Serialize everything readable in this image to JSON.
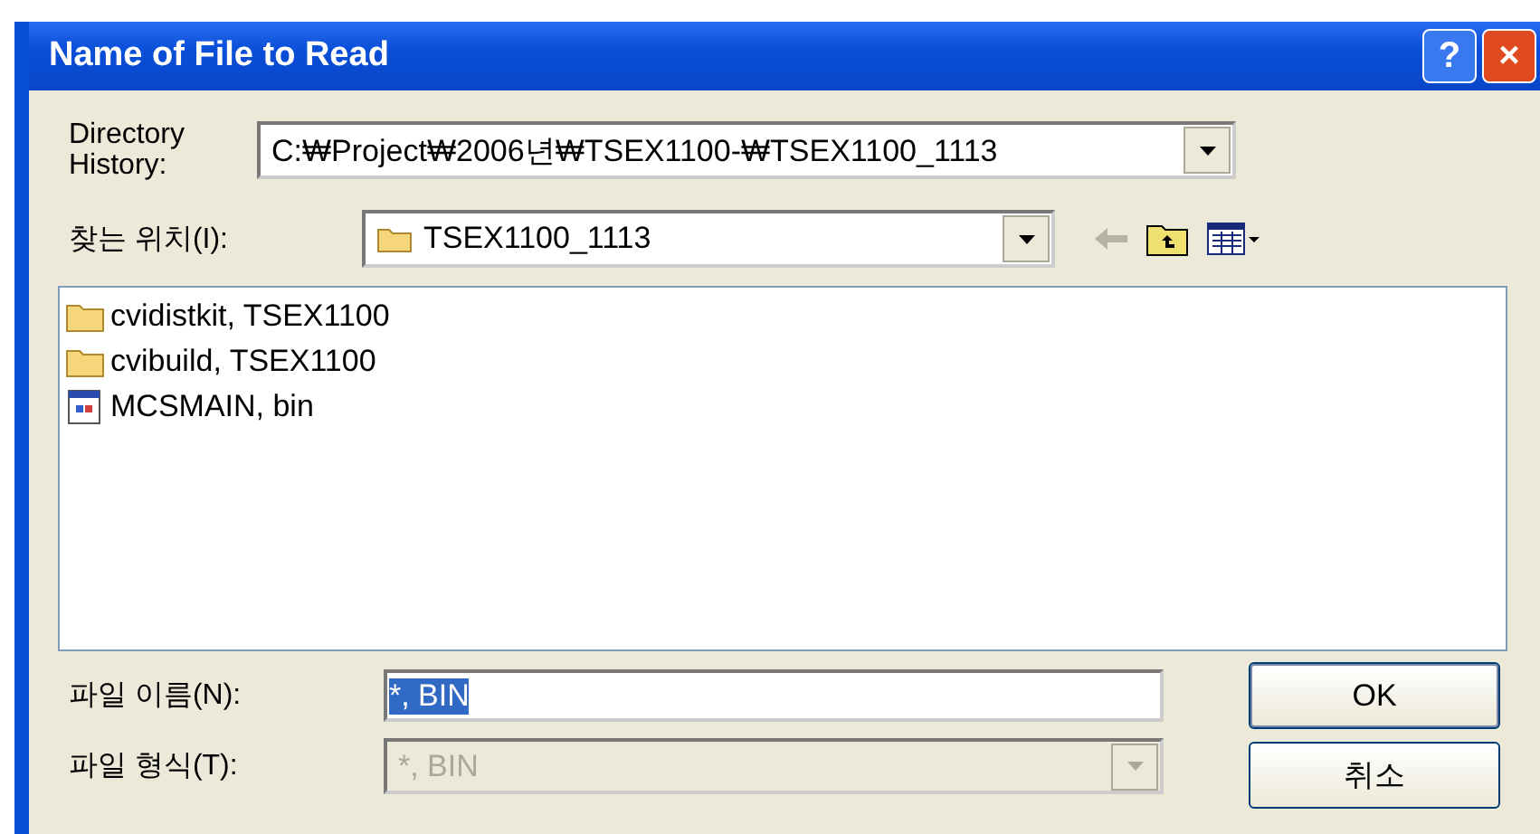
{
  "window": {
    "title": "Name of File to Read",
    "buttons": [
      {
        "kind": "help",
        "label": "?"
      },
      {
        "kind": "close",
        "label": "×"
      }
    ]
  },
  "directory_history": {
    "label": "Directory\nHistory:",
    "value": "C:₩Project₩2006년₩TSEX1100-₩TSEX1100_1113"
  },
  "look_in": {
    "label": "찾는 위치(I):",
    "value": "TSEX1100_1113"
  },
  "files": [
    {
      "kind": "folder",
      "name": "cvidistkit, TSEX1100"
    },
    {
      "kind": "folder",
      "name": "cvibuild, TSEX1100"
    },
    {
      "kind": "file",
      "name": "MCSMAIN, bin"
    }
  ],
  "file_name": {
    "label": "파일 이름(N):",
    "value": "*, BIN",
    "text_selected": true
  },
  "file_type": {
    "label": "파일 형식(T):",
    "value": "*, BIN",
    "disabled": true
  },
  "buttons": [
    {
      "kind": "ok",
      "label": "OK"
    },
    {
      "kind": "cancel",
      "label": "취소"
    }
  ]
}
